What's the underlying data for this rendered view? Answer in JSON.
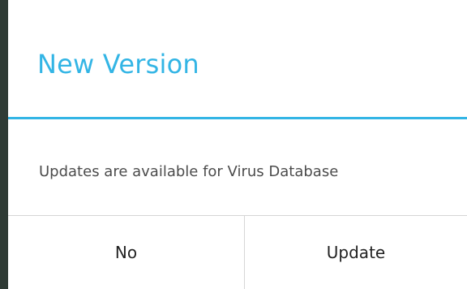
{
  "dialog": {
    "title": "New Version",
    "message": "Updates are available for Virus Database",
    "buttons": {
      "negative": "No",
      "positive": "Update"
    }
  },
  "colors": {
    "accent": "#33b5e5",
    "background_edge": "#2f3b35",
    "divider": "#d6d6d6"
  }
}
